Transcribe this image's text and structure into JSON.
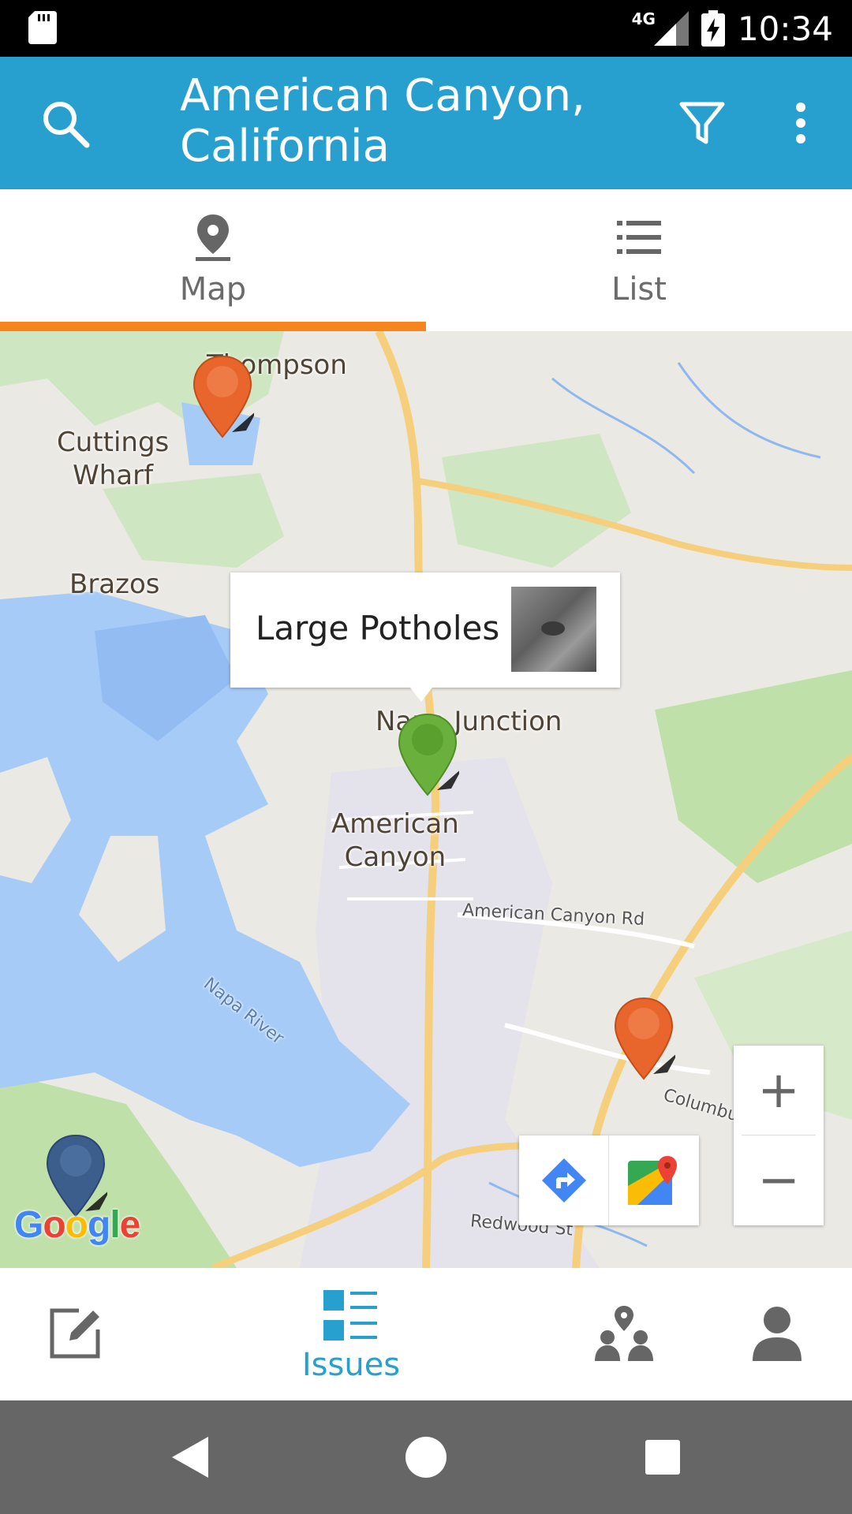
{
  "status_bar": {
    "network": "4G",
    "time": "10:34"
  },
  "app_bar": {
    "title": "American Canyon,\nCalifornia"
  },
  "tabs": [
    {
      "label": "Map",
      "icon": "map-pin-icon",
      "selected": true
    },
    {
      "label": "List",
      "icon": "list-icon",
      "selected": false
    }
  ],
  "map": {
    "places": [
      "Thompson",
      "Cuttings\nWharf",
      "Brazos",
      "Napa Junction",
      "American\nCanyon"
    ],
    "roads": [
      "American Canyon Rd",
      "Napa River",
      "Columbus Pkwy",
      "Redwood St"
    ],
    "info_window": {
      "title": "Large Potholes"
    },
    "pins": [
      {
        "color": "#e8652b",
        "status": "open"
      },
      {
        "color": "#6ab03c",
        "status": "selected"
      },
      {
        "color": "#e8652b",
        "status": "open"
      },
      {
        "color": "#3c5e8c",
        "status": "other"
      }
    ],
    "zoom": {
      "in": "+",
      "out": "−"
    },
    "attribution": "Google"
  },
  "bottom_nav": [
    {
      "label": "",
      "icon": "edit-icon"
    },
    {
      "label": "Issues",
      "icon": "issues-icon",
      "active": true
    },
    {
      "label": "",
      "icon": "community-icon"
    },
    {
      "label": "",
      "icon": "profile-icon"
    }
  ],
  "colors": {
    "primary": "#28a0cf",
    "accent": "#f7851e",
    "map_water": "#a6cbf7"
  }
}
